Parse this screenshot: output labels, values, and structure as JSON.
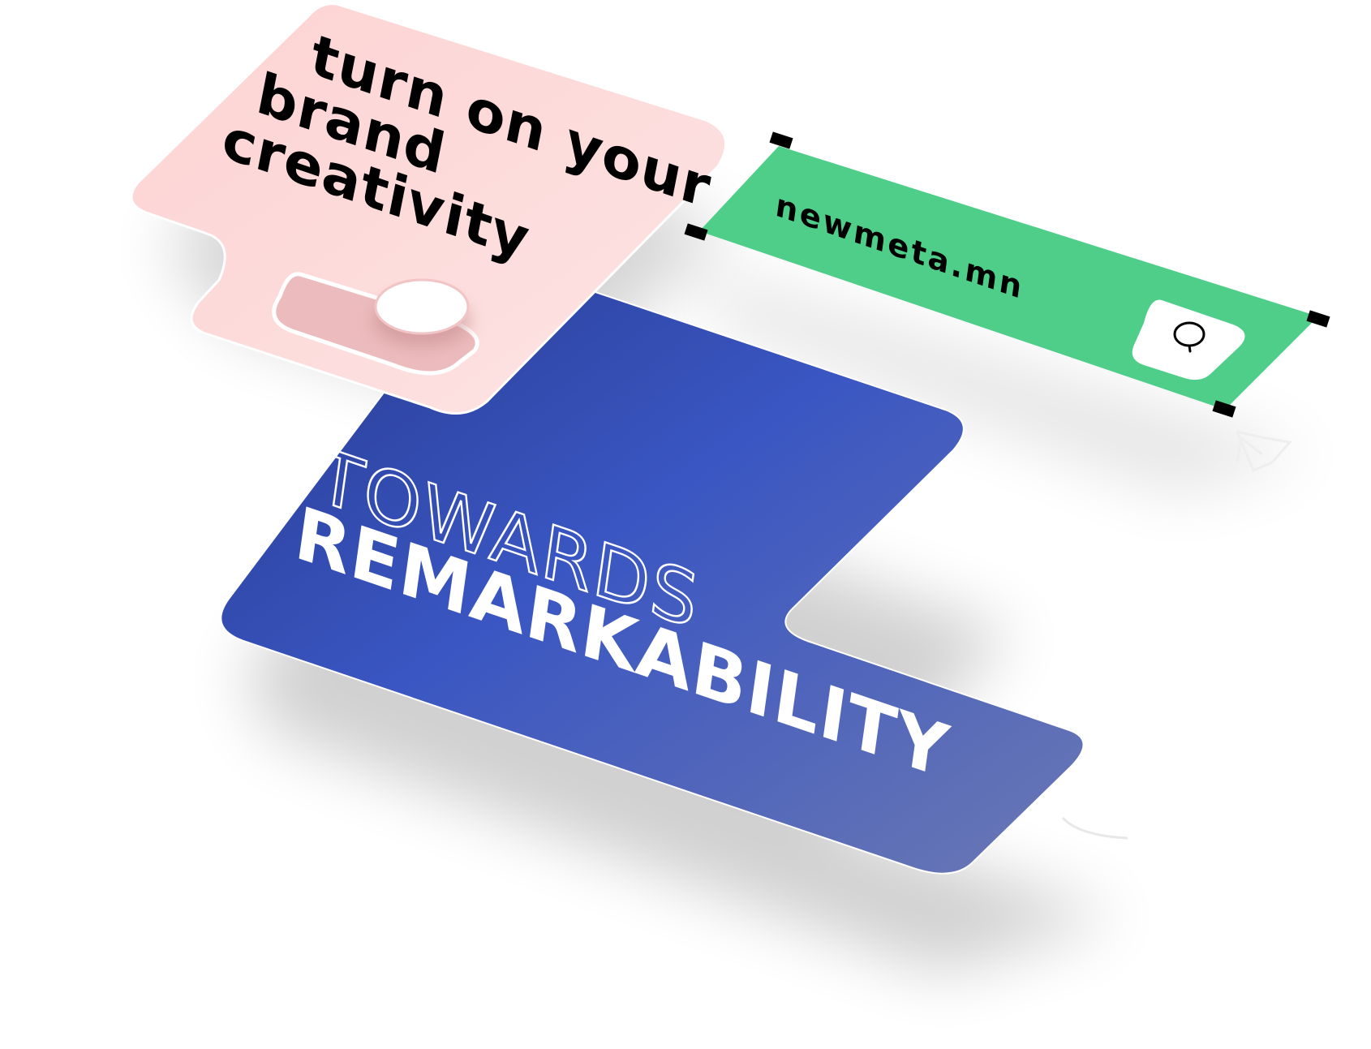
{
  "pink_card": {
    "lines": [
      "turn on your",
      "brand",
      "creativity"
    ],
    "toggle_state": "on"
  },
  "url_bar": {
    "url": "newmeta.mn",
    "search_icon": "search-icon"
  },
  "blue_card": {
    "line1": "TOWARDS",
    "line2": "REMARKABILITY"
  },
  "colors": {
    "pink_card": "#fcd6d6",
    "toggle_track": "#ecbcbe",
    "url_bar": "#4fce8a",
    "blue_card_dark": "#2a3e96",
    "blue_card_light": "#6a7cc0",
    "handle": "#000000"
  }
}
